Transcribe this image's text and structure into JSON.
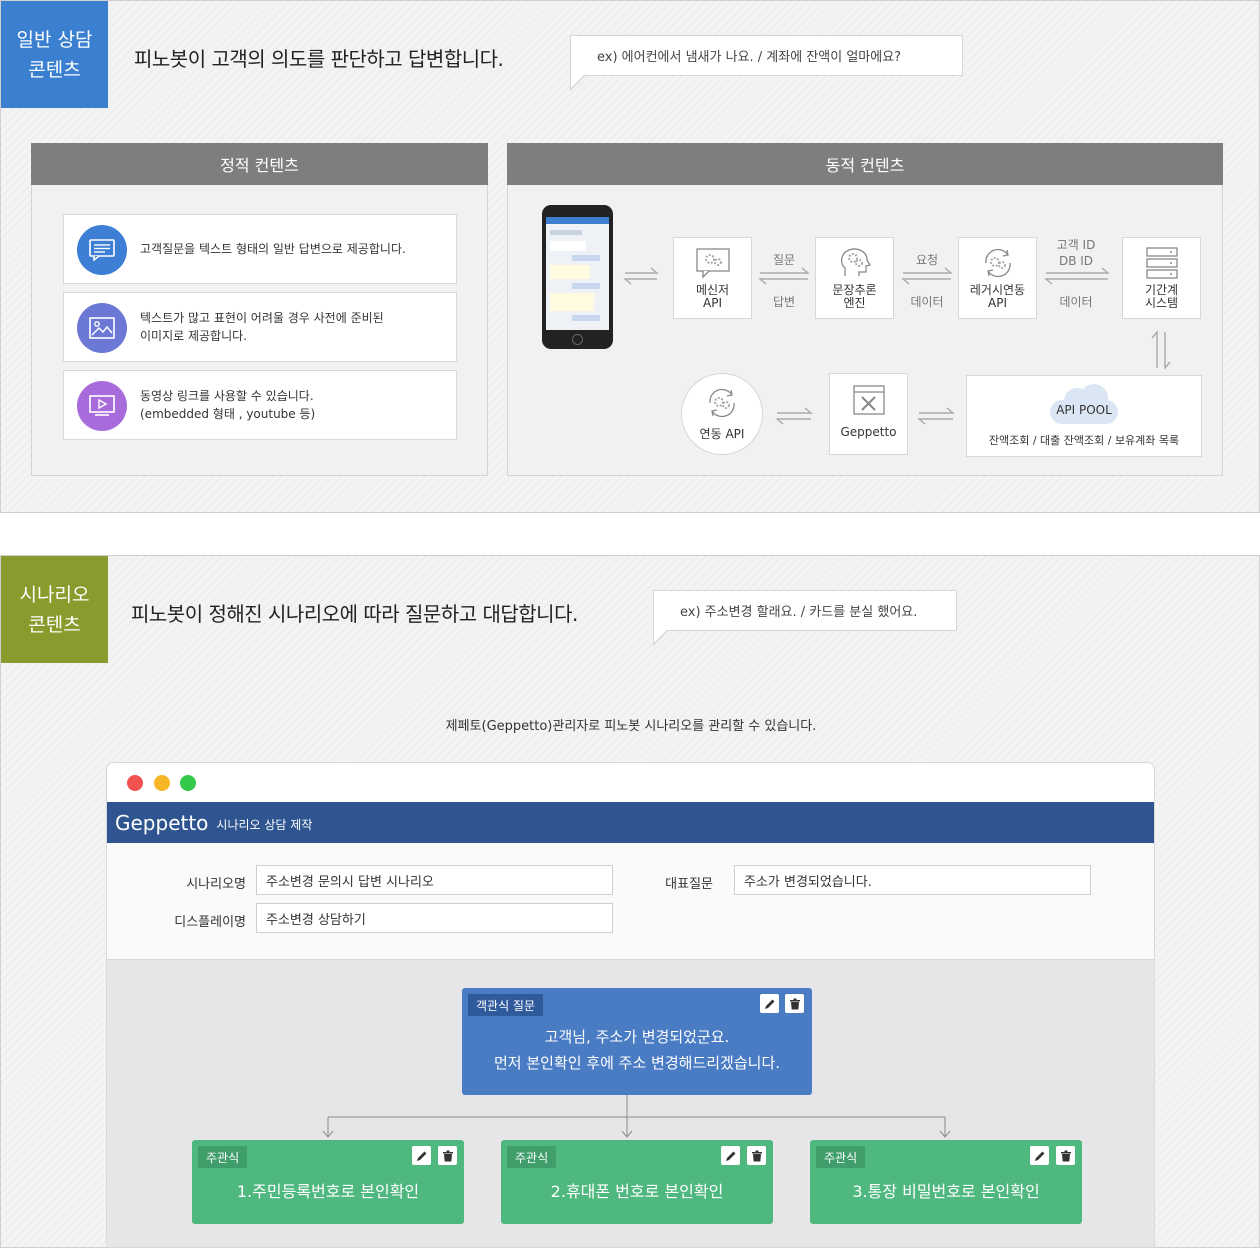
{
  "section1": {
    "tag": [
      "일반 상담",
      "콘텐츠"
    ],
    "tag_color": "#3b7fd1",
    "headline": "피노봇이 고객의 의도를 판단하고 답변합니다.",
    "example": "ex) 에어컨에서 냄새가 나요. / 계좌에 잔액이 얼마에요?",
    "static": {
      "title": "정적 컨텐츠",
      "items": [
        {
          "icon": "chat-text-icon",
          "color": "#3d7fd4",
          "lines": [
            "고객질문을 텍스트 형태의 일반 답변으로 제공합니다."
          ]
        },
        {
          "icon": "image-icon",
          "color": "#6b78d6",
          "lines": [
            "텍스트가 많고 표현이 어려울 경우 사전에 준비된",
            "이미지로 제공합니다."
          ]
        },
        {
          "icon": "video-icon",
          "color": "#a86bdc",
          "lines": [
            "동영상 링크를 사용할 수 있습니다.",
            "(embedded 형태 , youtube 등)"
          ]
        }
      ]
    },
    "dynamic": {
      "title": "동적 컨텐츠",
      "nodes": {
        "messenger": [
          "메신저",
          "API"
        ],
        "engine": [
          "문장추론",
          "엔진"
        ],
        "legacy": [
          "레거시연동",
          "API"
        ],
        "core": [
          "기간계",
          "시스템"
        ],
        "geppetto": "Geppetto",
        "link_api": "연동 API",
        "api_pool": "API POOL",
        "api_pool_desc": "잔액조회 / 대출 잔액조회 / 보유계좌 목록"
      },
      "labels": {
        "question": "질문",
        "answer": "답변",
        "request": "요청",
        "data1": "데이터",
        "customer_id": "고객 ID",
        "db_id": "DB ID",
        "data2": "데이터"
      }
    }
  },
  "section2": {
    "tag": [
      "시나리오",
      "콘텐츠"
    ],
    "tag_color": "#8a9a2c",
    "headline": "피노봇이 정해진 시나리오에 따라  질문하고 대답합니다.",
    "example": "ex) 주소변경 할래요. / 카드를 분실 했어요.",
    "caption": "제페토(Geppetto)관리자로 피노봇 시나리오를 관리할 수 있습니다.",
    "window": {
      "brand": "Geppetto",
      "subtitle": "시나리오 상담 제작",
      "form": {
        "scenario_label": "시나리오명",
        "scenario_value": "주소변경 문의시 답변 시나리오",
        "display_label": "디스플레이명",
        "display_value": "주소변경 상담하기",
        "rep_label": "대표질문",
        "rep_value": "주소가 변경되었습니다."
      },
      "question_card": {
        "tag": "객관식 질문",
        "lines": [
          "고객님, 주소가 변경되었군요.",
          "먼저 본인확인 후에 주소 변경해드리겠습니다."
        ]
      },
      "answer_cards": [
        {
          "tag": "주관식",
          "text": "1.주민등록번호로 본인확인"
        },
        {
          "tag": "주관식",
          "text": "2.휴대폰 번호로 본인확인"
        },
        {
          "tag": "주관식",
          "text": "3.통장 비밀번호로 본인확인"
        }
      ]
    }
  },
  "colors": {
    "question_card": "#4a7cc4",
    "answer_card": "#4fb87f",
    "titlebar": "#2f5590",
    "box_header": "#7e7e80"
  }
}
